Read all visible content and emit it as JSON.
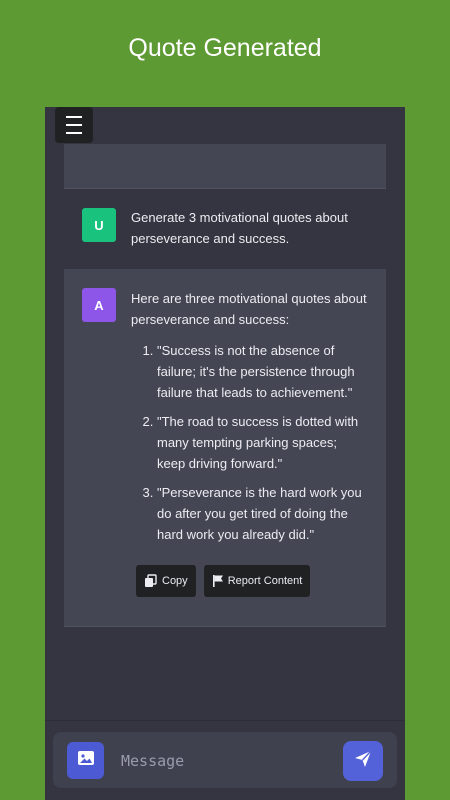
{
  "banner": {
    "title": "Quote Generated"
  },
  "conversation": {
    "user": {
      "avatar_letter": "U",
      "text": "Generate 3 motivational quotes about perseverance and success."
    },
    "assistant": {
      "avatar_letter": "A",
      "intro": "Here are three motivational quotes about perseverance and success:",
      "quotes": [
        "\"Success is not the absence of failure; it's the persistence through failure that leads to achievement.\"",
        "\"The road to success is dotted with many tempting parking spaces; keep driving forward.\"",
        "\"Perseverance is the hard work you do after you get tired of doing the hard work you already did.\""
      ],
      "actions": {
        "copy_label": "Copy",
        "report_label": "Report Content"
      }
    }
  },
  "composer": {
    "placeholder": "Message"
  },
  "icons": {
    "menu": "hamburger-menu-icon",
    "copy": "copy-icon",
    "report": "flag-icon",
    "image": "image-icon",
    "send": "send-icon"
  },
  "colors": {
    "background": "#5e9a33",
    "app_background": "#343541",
    "assistant_panel": "#444654",
    "user_avatar": "#19c37d",
    "assistant_avatar": "#8e55e9",
    "accent": "#5462d9"
  }
}
